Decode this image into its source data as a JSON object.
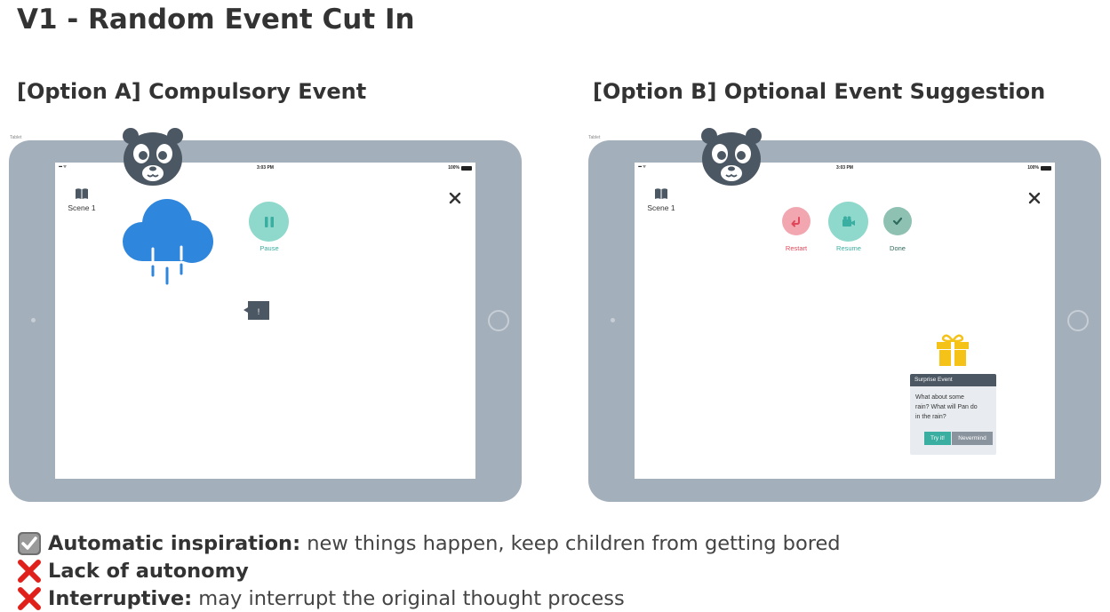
{
  "title": "V1 - Random Event Cut In",
  "option_a": {
    "title": "[Option A] Compulsory Event",
    "tablet_caption": "Tablet",
    "status": {
      "time": "3:03 PM",
      "battery": "100%"
    },
    "scene_label": "Scene 1",
    "pause_label": "Pause",
    "alert_text": "!"
  },
  "option_b": {
    "title": "[Option B] Optional Event Suggestion",
    "tablet_caption": "Tablet",
    "status": {
      "time": "3:03 PM",
      "battery": "100%"
    },
    "scene_label": "Scene 1",
    "actions": {
      "restart": "Restart",
      "resume": "Resume",
      "done": "Done"
    },
    "popup": {
      "header": "Surprise Event",
      "body_line1": "What about some",
      "body_line2": "rain? What will Pan do",
      "body_line3": "in the rain?",
      "try_label": "Try it!",
      "nevermind_label": "Nevermind"
    }
  },
  "pros_cons": [
    {
      "kind": "check",
      "bold": "Automatic inspiration:",
      "text": " new things happen, keep children from getting bored"
    },
    {
      "kind": "cross",
      "bold": "Lack of autonomy",
      "text": ""
    },
    {
      "kind": "cross",
      "bold": "Interruptive:",
      "text": " may interrupt the original thought process"
    }
  ],
  "colors": {
    "tablet_frame": "#a3afbb",
    "cloud_blue": "#2f86dd",
    "teal": "#8fd8cc",
    "teal_dark": "#3aaea0",
    "restart_pink": "#f2a7b0",
    "restart_red": "#e0475a",
    "done_green": "#8fc1b3",
    "panda_gray": "#4b5763",
    "gift_yellow": "#f5c218",
    "cross_red": "#e0201b"
  },
  "icons": [
    "book-icon",
    "close-icon",
    "cloud-rain-icon",
    "pause-icon",
    "panda-icon",
    "alert-bubble-icon",
    "restart-icon",
    "camera-icon",
    "check-icon",
    "gift-icon",
    "checkbox-icon",
    "cross-icon"
  ]
}
